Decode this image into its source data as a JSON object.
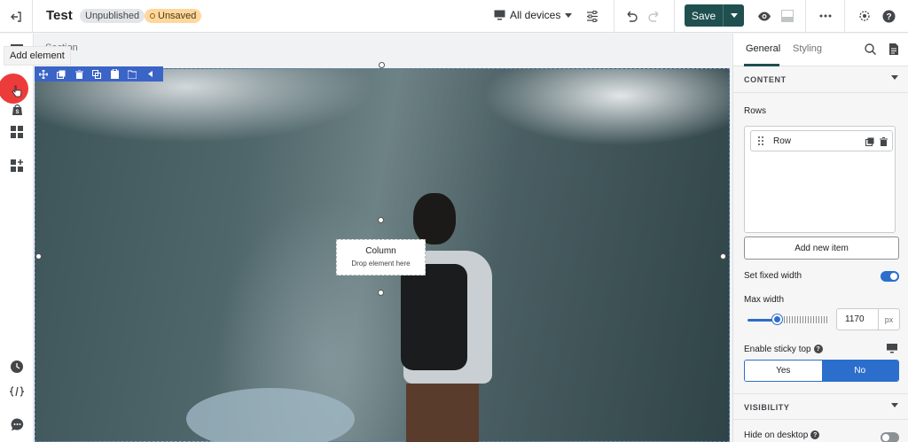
{
  "header": {
    "title": "Test",
    "status_badge": "Unpublished",
    "unsaved_badge": "Unsaved",
    "device_label": "All devices",
    "save_label": "Save"
  },
  "rail": {
    "tooltip": "Add element"
  },
  "canvas": {
    "section_label": "Section",
    "column_title": "Column",
    "column_placeholder": "Drop element here"
  },
  "panel": {
    "tabs": [
      {
        "label": "General",
        "active": true
      },
      {
        "label": "Styling",
        "active": false
      }
    ],
    "content_section": "CONTENT",
    "rows_label": "Rows",
    "row_item_label": "Row",
    "add_item_label": "Add new item",
    "fixed_width_label": "Set fixed width",
    "fixed_width_on": true,
    "max_width_label": "Max width",
    "max_width_value": "1170",
    "max_width_unit": "px",
    "sticky_label": "Enable sticky top",
    "sticky_options": [
      "Yes",
      "No"
    ],
    "sticky_selected": "No",
    "visibility_section": "VISIBILITY",
    "hide_desktop_label": "Hide on desktop",
    "hide_desktop_on": false
  },
  "colors": {
    "accent": "#2c6ecb",
    "save_bg": "#1f4f4f",
    "rail_highlight": "#ec3b3b",
    "unsaved_badge": "#ffd79d"
  }
}
